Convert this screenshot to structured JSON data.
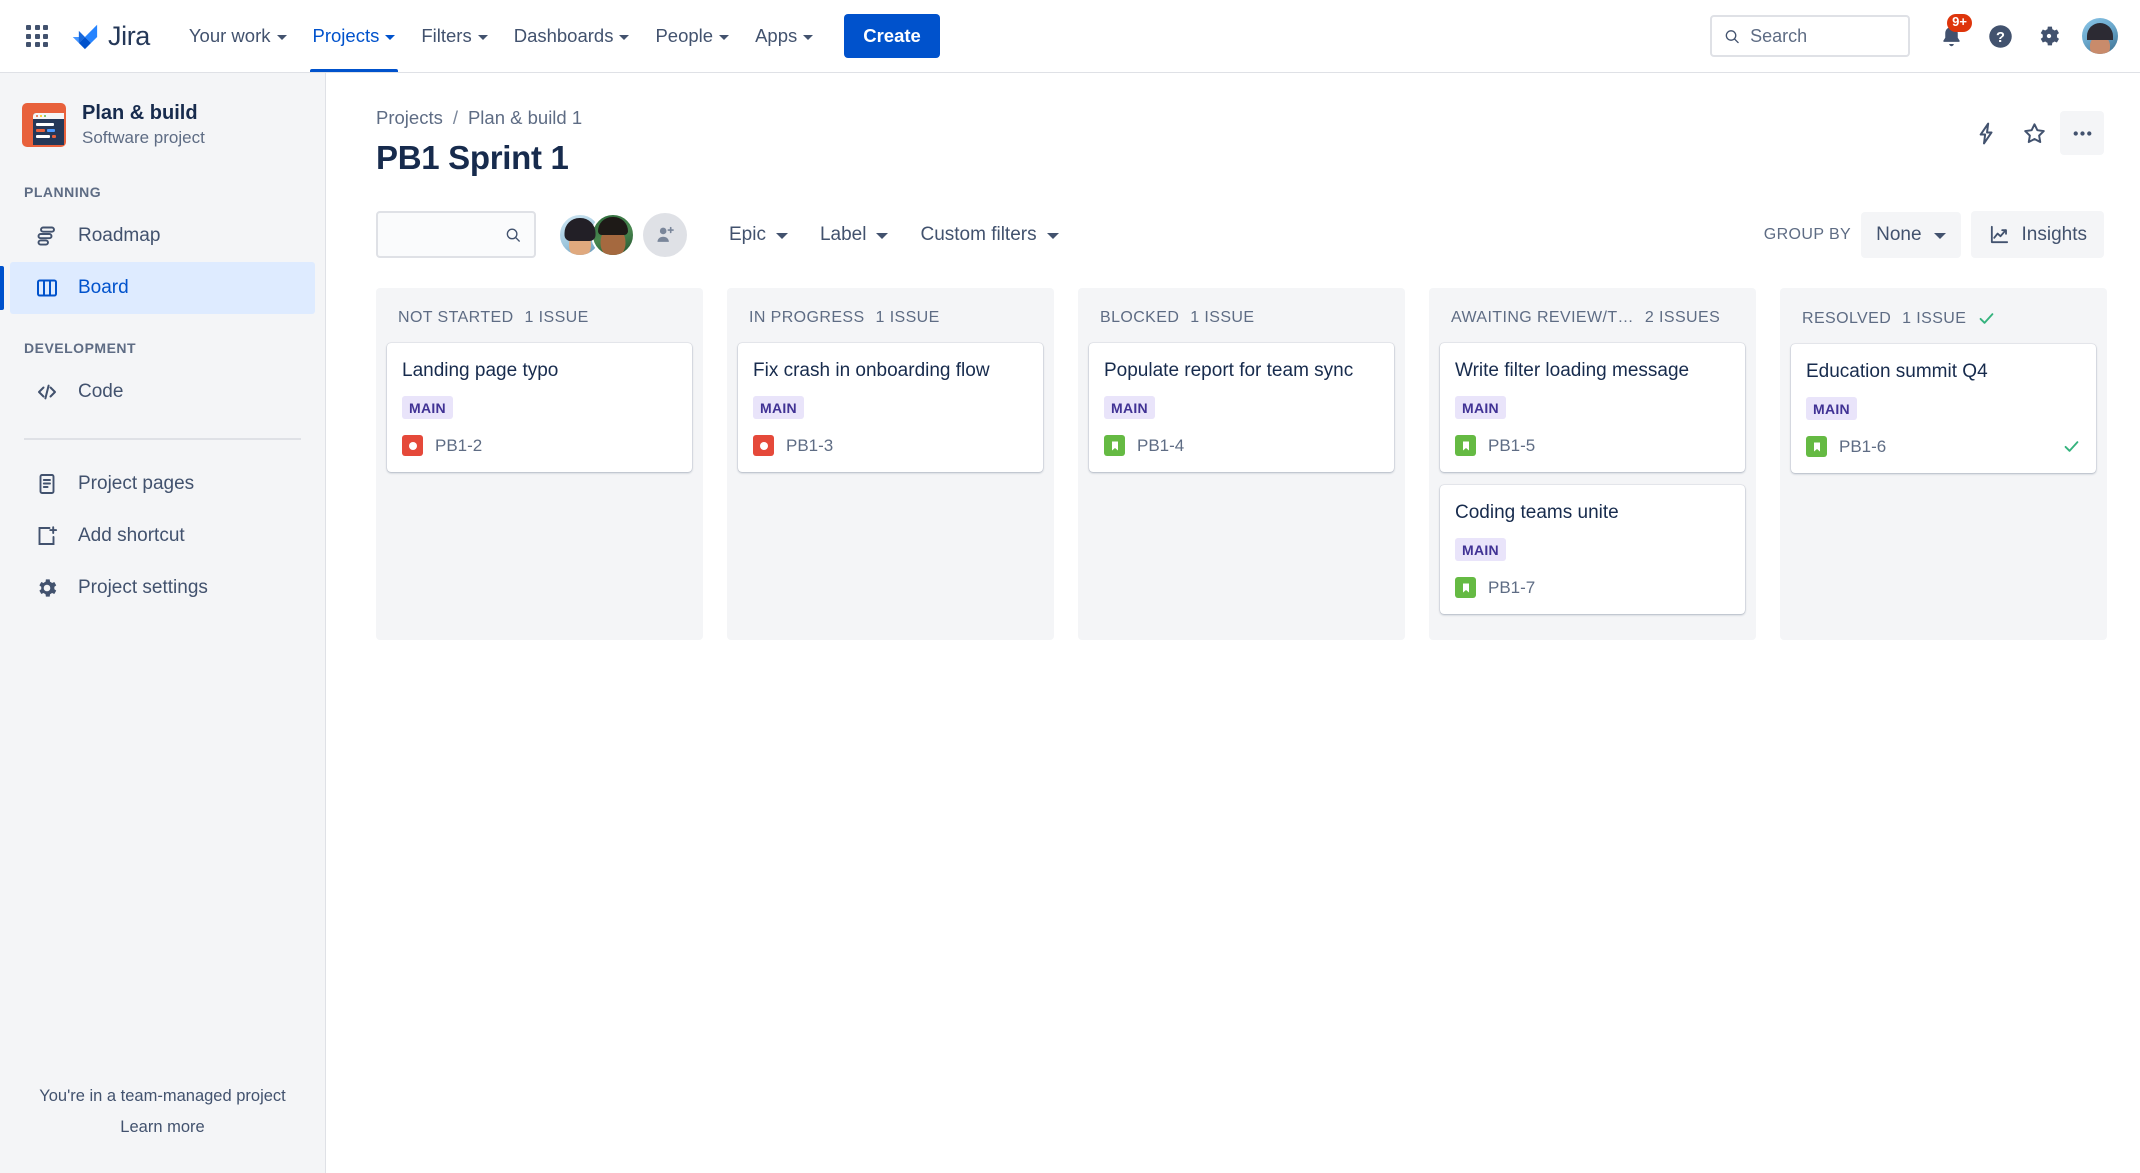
{
  "topnav": {
    "app_switcher_icon": "grid-apps-icon",
    "brand": "Jira",
    "items": [
      {
        "label": "Your work",
        "active": false
      },
      {
        "label": "Projects",
        "active": true
      },
      {
        "label": "Filters",
        "active": false
      },
      {
        "label": "Dashboards",
        "active": false
      },
      {
        "label": "People",
        "active": false
      },
      {
        "label": "Apps",
        "active": false
      }
    ],
    "create_label": "Create",
    "search_placeholder": "Search",
    "search_value": "",
    "notification_badge": "9+",
    "icons": {
      "search": "search-icon",
      "notifications": "notification-bell-icon",
      "help": "help-circle-icon",
      "settings": "gear-icon",
      "profile": "user-avatar"
    }
  },
  "sidebar": {
    "project_name": "Plan & build",
    "project_type": "Software project",
    "sections": [
      {
        "label": "PLANNING",
        "items": [
          {
            "label": "Roadmap",
            "icon": "roadmap-icon",
            "active": false
          },
          {
            "label": "Board",
            "icon": "board-columns-icon",
            "active": true
          }
        ]
      },
      {
        "label": "DEVELOPMENT",
        "items": [
          {
            "label": "Code",
            "icon": "code-brackets-icon",
            "active": false
          }
        ]
      }
    ],
    "extra_items": [
      {
        "label": "Project pages",
        "icon": "page-document-icon"
      },
      {
        "label": "Add shortcut",
        "icon": "add-shortcut-icon"
      },
      {
        "label": "Project settings",
        "icon": "gear-icon"
      }
    ],
    "footer_text": "You're in a team-managed project",
    "footer_link": "Learn more"
  },
  "breadcrumb": {
    "items": [
      "Projects",
      "Plan & build 1"
    ],
    "separator": "/"
  },
  "page": {
    "title": "PB1 Sprint 1",
    "actions": [
      {
        "name": "lightning-bolt-icon"
      },
      {
        "name": "star-icon"
      },
      {
        "name": "more-options-icon"
      }
    ]
  },
  "toolbar": {
    "search_value": "",
    "search_placeholder": "",
    "search_icon": "search-icon",
    "avatars": [
      "user-avatar-1",
      "user-avatar-2"
    ],
    "add_people_icon": "add-person-icon",
    "filters": [
      {
        "label": "Epic"
      },
      {
        "label": "Label"
      },
      {
        "label": "Custom filters"
      }
    ],
    "group_by_label": "GROUP BY",
    "group_by_value": "None",
    "insights_label": "Insights",
    "insights_icon": "trend-chart-icon"
  },
  "board": {
    "columns": [
      {
        "name": "NOT STARTED",
        "count": "1 ISSUE",
        "done": false,
        "cards": [
          {
            "title": "Landing page typo",
            "epic": "MAIN",
            "key": "PB1-2",
            "type": "bug",
            "resolved": false
          }
        ]
      },
      {
        "name": "IN PROGRESS",
        "count": "1 ISSUE",
        "done": false,
        "cards": [
          {
            "title": "Fix crash in onboarding flow",
            "epic": "MAIN",
            "key": "PB1-3",
            "type": "bug",
            "resolved": false
          }
        ]
      },
      {
        "name": "BLOCKED",
        "count": "1 ISSUE",
        "done": false,
        "cards": [
          {
            "title": "Populate report for team sync",
            "epic": "MAIN",
            "key": "PB1-4",
            "type": "story",
            "resolved": false
          }
        ]
      },
      {
        "name": "AWAITING REVIEW/T…",
        "count": "2 ISSUES",
        "done": false,
        "cards": [
          {
            "title": "Write filter loading message",
            "epic": "MAIN",
            "key": "PB1-5",
            "type": "story",
            "resolved": false
          },
          {
            "title": "Coding teams unite",
            "epic": "MAIN",
            "key": "PB1-7",
            "type": "story",
            "resolved": false
          }
        ]
      },
      {
        "name": "RESOLVED",
        "count": "1 ISSUE",
        "done": true,
        "cards": [
          {
            "title": "Education summit Q4",
            "epic": "MAIN",
            "key": "PB1-6",
            "type": "story",
            "resolved": true
          }
        ]
      }
    ]
  },
  "colors": {
    "brand_blue": "#0052CC",
    "selected_bg": "#DEEBFF",
    "column_bg": "#F4F5F7",
    "epic_bg": "#E9E4FA",
    "epic_text": "#403294",
    "bug_red": "#E5493A",
    "story_green": "#65BA43",
    "badge_red": "#DE350B",
    "done_green": "#36B37E",
    "project_icon_orange": "#E8613C"
  }
}
